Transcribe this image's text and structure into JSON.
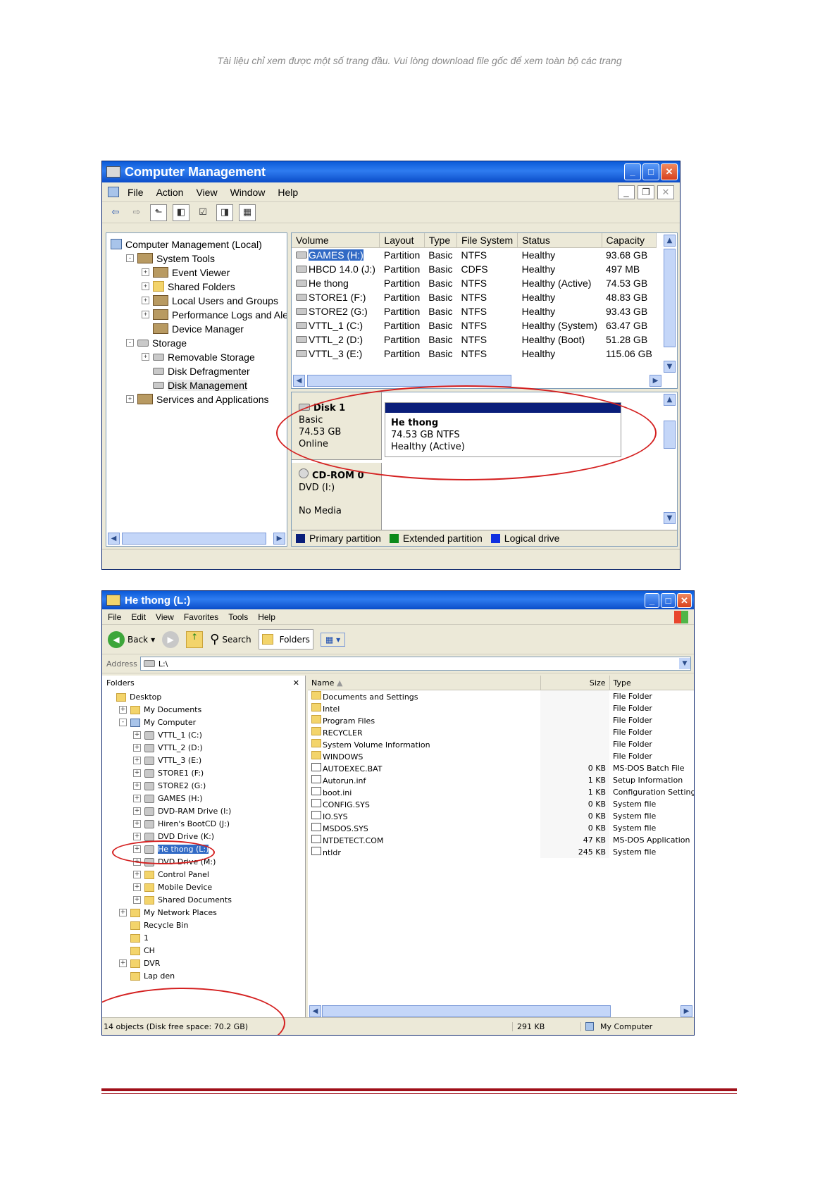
{
  "notice": "Tài liệu chỉ xem được một số trang đầu. Vui lòng download file gốc để xem toàn bộ các trang",
  "cm": {
    "title": "Computer Management",
    "menu": [
      "File",
      "Action",
      "View",
      "Window",
      "Help"
    ],
    "tree": [
      {
        "label": "Computer Management (Local)",
        "level": 0,
        "icon": "computer-icon",
        "expander": ""
      },
      {
        "label": "System Tools",
        "level": 1,
        "icon": "tools-icon",
        "expander": "-"
      },
      {
        "label": "Event Viewer",
        "level": 2,
        "icon": "event-viewer-icon",
        "expander": "+"
      },
      {
        "label": "Shared Folders",
        "level": 2,
        "icon": "folder-icon",
        "expander": "+"
      },
      {
        "label": "Local Users and Groups",
        "level": 2,
        "icon": "users-icon",
        "expander": "+"
      },
      {
        "label": "Performance Logs and Alert:",
        "level": 2,
        "icon": "performance-icon",
        "expander": "+"
      },
      {
        "label": "Device Manager",
        "level": 2,
        "icon": "device-manager-icon",
        "expander": ""
      },
      {
        "label": "Storage",
        "level": 1,
        "icon": "storage-icon",
        "expander": "-"
      },
      {
        "label": "Removable Storage",
        "level": 2,
        "icon": "removable-storage-icon",
        "expander": "+"
      },
      {
        "label": "Disk Defragmenter",
        "level": 2,
        "icon": "defrag-icon",
        "expander": ""
      },
      {
        "label": "Disk Management",
        "level": 2,
        "icon": "disk-management-icon",
        "expander": ""
      },
      {
        "label": "Services and Applications",
        "level": 1,
        "icon": "services-icon",
        "expander": "+"
      }
    ],
    "columns": [
      "Volume",
      "Layout",
      "Type",
      "File System",
      "Status",
      "Capacity"
    ],
    "volumes": [
      [
        "GAMES (H:)",
        "Partition",
        "Basic",
        "NTFS",
        "Healthy",
        "93.68 GB"
      ],
      [
        "HBCD 14.0 (J:)",
        "Partition",
        "Basic",
        "CDFS",
        "Healthy",
        "497 MB"
      ],
      [
        "He thong",
        "Partition",
        "Basic",
        "NTFS",
        "Healthy (Active)",
        "74.53 GB"
      ],
      [
        "STORE1 (F:)",
        "Partition",
        "Basic",
        "NTFS",
        "Healthy",
        "48.83 GB"
      ],
      [
        "STORE2 (G:)",
        "Partition",
        "Basic",
        "NTFS",
        "Healthy",
        "93.43 GB"
      ],
      [
        "VTTL_1 (C:)",
        "Partition",
        "Basic",
        "NTFS",
        "Healthy (System)",
        "63.47 GB"
      ],
      [
        "VTTL_2 (D:)",
        "Partition",
        "Basic",
        "NTFS",
        "Healthy (Boot)",
        "51.28 GB"
      ],
      [
        "VTTL_3 (E:)",
        "Partition",
        "Basic",
        "NTFS",
        "Healthy",
        "115.06 GB"
      ]
    ],
    "disk1": {
      "name": "Disk 1",
      "type": "Basic",
      "size": "74.53 GB",
      "state": "Online",
      "part_name": "He thong",
      "part_fs": "74.53 GB NTFS",
      "part_status": "Healthy (Active)"
    },
    "cdrom": {
      "name": "CD-ROM 0",
      "type": "DVD (I:)",
      "state": "No Media"
    },
    "legend": [
      {
        "label": "Primary partition",
        "color": "#0a1e7a"
      },
      {
        "label": "Extended partition",
        "color": "#0c8a1a"
      },
      {
        "label": "Logical drive",
        "color": "#1030e0"
      }
    ]
  },
  "ex": {
    "title": "He thong (L:)",
    "menu": [
      "File",
      "Edit",
      "View",
      "Favorites",
      "Tools",
      "Help"
    ],
    "back": "Back",
    "search": "Search",
    "folders_btn": "Folders",
    "address_label": "Address",
    "address": "L:\\",
    "folders_header": "Folders",
    "tree": [
      {
        "label": "Desktop",
        "level": 0,
        "expander": "",
        "icon": "desktop-icon"
      },
      {
        "label": "My Documents",
        "level": 1,
        "expander": "+",
        "icon": "folder-icon"
      },
      {
        "label": "My Computer",
        "level": 1,
        "expander": "-",
        "icon": "computer-icon"
      },
      {
        "label": "VTTL_1 (C:)",
        "level": 2,
        "expander": "+",
        "icon": "drive-icon"
      },
      {
        "label": "VTTL_2 (D:)",
        "level": 2,
        "expander": "+",
        "icon": "drive-icon"
      },
      {
        "label": "VTTL_3 (E:)",
        "level": 2,
        "expander": "+",
        "icon": "drive-icon"
      },
      {
        "label": "STORE1 (F:)",
        "level": 2,
        "expander": "+",
        "icon": "drive-icon"
      },
      {
        "label": "STORE2 (G:)",
        "level": 2,
        "expander": "+",
        "icon": "drive-icon"
      },
      {
        "label": "GAMES (H:)",
        "level": 2,
        "expander": "+",
        "icon": "drive-icon"
      },
      {
        "label": "DVD-RAM Drive (I:)",
        "level": 2,
        "expander": "+",
        "icon": "cd-drive-icon"
      },
      {
        "label": "Hiren's BootCD (J:)",
        "level": 2,
        "expander": "+",
        "icon": "cd-drive-icon"
      },
      {
        "label": "DVD Drive (K:)",
        "level": 2,
        "expander": "+",
        "icon": "cd-drive-icon"
      },
      {
        "label": "He thong (L:)",
        "level": 2,
        "expander": "+",
        "icon": "drive-icon"
      },
      {
        "label": "DVD Drive (M:)",
        "level": 2,
        "expander": "+",
        "icon": "cd-drive-icon"
      },
      {
        "label": "Control Panel",
        "level": 2,
        "expander": "+",
        "icon": "control-panel-icon"
      },
      {
        "label": "Mobile Device",
        "level": 2,
        "expander": "+",
        "icon": "mobile-device-icon"
      },
      {
        "label": "Shared Documents",
        "level": 2,
        "expander": "+",
        "icon": "folder-icon"
      },
      {
        "label": "My Network Places",
        "level": 1,
        "expander": "+",
        "icon": "network-icon"
      },
      {
        "label": "Recycle Bin",
        "level": 1,
        "expander": "",
        "icon": "recycle-bin-icon"
      },
      {
        "label": "1",
        "level": 1,
        "expander": "",
        "icon": "folder-icon"
      },
      {
        "label": "CH",
        "level": 1,
        "expander": "",
        "icon": "folder-icon"
      },
      {
        "label": "DVR",
        "level": 1,
        "expander": "+",
        "icon": "folder-icon"
      },
      {
        "label": "Lap den",
        "level": 1,
        "expander": "",
        "icon": "folder-icon"
      }
    ],
    "columns": [
      "Name",
      "Size",
      "Type"
    ],
    "files": [
      {
        "name": "Documents and Settings",
        "size": "",
        "type": "File Folder",
        "icon": "folder-icon"
      },
      {
        "name": "Intel",
        "size": "",
        "type": "File Folder",
        "icon": "folder-icon"
      },
      {
        "name": "Program Files",
        "size": "",
        "type": "File Folder",
        "icon": "folder-icon"
      },
      {
        "name": "RECYCLER",
        "size": "",
        "type": "File Folder",
        "icon": "folder-icon"
      },
      {
        "name": "System Volume Information",
        "size": "",
        "type": "File Folder",
        "icon": "folder-icon"
      },
      {
        "name": "WINDOWS",
        "size": "",
        "type": "File Folder",
        "icon": "folder-icon"
      },
      {
        "name": "AUTOEXEC.BAT",
        "size": "0 KB",
        "type": "MS-DOS Batch File",
        "icon": "batch-file-icon"
      },
      {
        "name": "Autorun.inf",
        "size": "1 KB",
        "type": "Setup Information",
        "icon": "setup-file-icon"
      },
      {
        "name": "boot.ini",
        "size": "1 KB",
        "type": "Configuration Settings",
        "icon": "config-file-icon"
      },
      {
        "name": "CONFIG.SYS",
        "size": "0 KB",
        "type": "System file",
        "icon": "system-file-icon"
      },
      {
        "name": "IO.SYS",
        "size": "0 KB",
        "type": "System file",
        "icon": "system-file-icon"
      },
      {
        "name": "MSDOS.SYS",
        "size": "0 KB",
        "type": "System file",
        "icon": "system-file-icon"
      },
      {
        "name": "NTDETECT.COM",
        "size": "47 KB",
        "type": "MS-DOS Application",
        "icon": "application-icon"
      },
      {
        "name": "ntldr",
        "size": "245 KB",
        "type": "System file",
        "icon": "system-file-icon"
      }
    ],
    "status_left": "14 objects (Disk free space: 70.2 GB)",
    "status_size": "291 KB",
    "status_zone": "My Computer"
  }
}
